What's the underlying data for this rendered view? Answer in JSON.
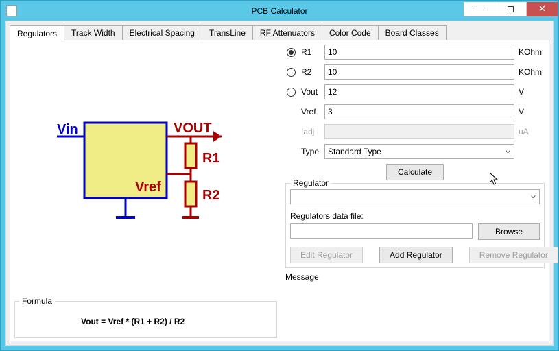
{
  "window": {
    "title": "PCB Calculator"
  },
  "tabs": [
    "Regulators",
    "Track Width",
    "Electrical Spacing",
    "TransLine",
    "RF Attenuators",
    "Color Code",
    "Board Classes"
  ],
  "active_tab": 0,
  "fields": {
    "r1": {
      "label": "R1",
      "value": "10",
      "unit": "KOhm",
      "radio": true,
      "checked": true
    },
    "r2": {
      "label": "R2",
      "value": "10",
      "unit": "KOhm",
      "radio": true,
      "checked": false
    },
    "vout": {
      "label": "Vout",
      "value": "12",
      "unit": "V",
      "radio": true,
      "checked": false
    },
    "vref": {
      "label": "Vref",
      "value": "3",
      "unit": "V",
      "radio": false
    },
    "iadj": {
      "label": "Iadj",
      "value": "",
      "unit": "uA",
      "radio": false,
      "disabled": true
    },
    "type": {
      "label": "Type",
      "value": "Standard Type"
    }
  },
  "buttons": {
    "calculate": "Calculate",
    "browse": "Browse",
    "edit_regulator": "Edit Regulator",
    "add_regulator": "Add Regulator",
    "remove_regulator": "Remove Regulator"
  },
  "regulator": {
    "group_label": "Regulator",
    "selected": "",
    "data_file_label": "Regulators data file:",
    "data_file_value": ""
  },
  "message_label": "Message",
  "formula": {
    "group_label": "Formula",
    "text": "Vout = Vref * (R1 + R2) / R2"
  },
  "diagram": {
    "vin": "Vin",
    "vout": "VOUT",
    "vref": "Vref",
    "r1": "R1",
    "r2": "R2"
  }
}
